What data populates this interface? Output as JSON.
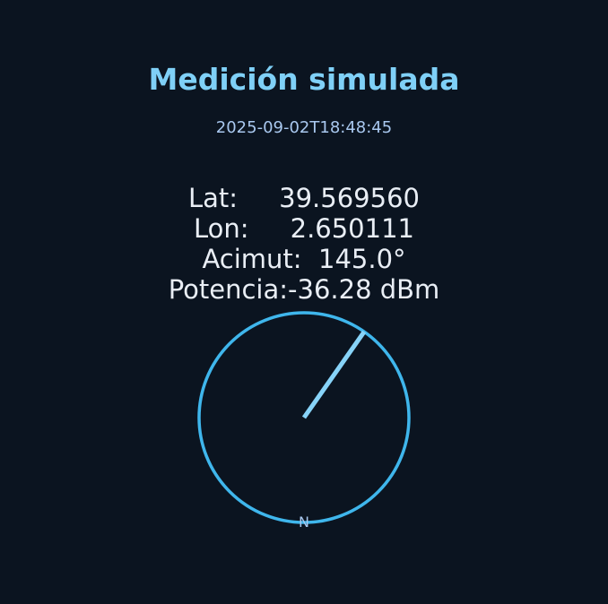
{
  "title": "Medición simulada",
  "timestamp": "2025-09-02T18:48:45",
  "readout": {
    "lat": "Lat:     39.569560",
    "lon": "Lon:     2.650111",
    "azimuth": "Acimut:  145.0°",
    "power": "Potencia:-36.28 dBm"
  },
  "compass": {
    "azimuth_deg": 145.0,
    "north_label": "N",
    "ring_color": "#3fb6ec",
    "needle_color": "#87d3f8"
  }
}
